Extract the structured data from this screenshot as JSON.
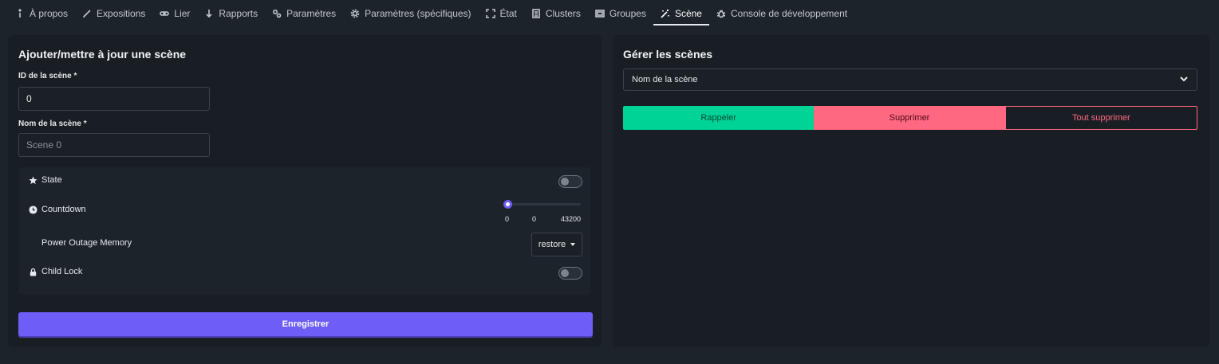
{
  "tabs": [
    {
      "label": "À propos",
      "icon": "info-icon"
    },
    {
      "label": "Expositions",
      "icon": "pencil-icon"
    },
    {
      "label": "Lier",
      "icon": "link-icon"
    },
    {
      "label": "Rapports",
      "icon": "arrow-down-icon"
    },
    {
      "label": "Paramètres",
      "icon": "cogs-icon"
    },
    {
      "label": "Paramètres (spécifiques)",
      "icon": "gear-icon"
    },
    {
      "label": "État",
      "icon": "expand-icon"
    },
    {
      "label": "Clusters",
      "icon": "list-icon"
    },
    {
      "label": "Groupes",
      "icon": "group-icon"
    },
    {
      "label": "Scène",
      "icon": "magic-wand-icon",
      "active": true
    },
    {
      "label": "Console de développement",
      "icon": "bug-icon"
    }
  ],
  "left": {
    "title": "Ajouter/mettre à jour une scène",
    "scene_id_label": "ID de la scène *",
    "scene_id_value": "0",
    "scene_name_label": "Nom de la scène *",
    "scene_name_placeholder": "Scene 0",
    "state_label": "State",
    "countdown_label": "Countdown",
    "countdown_min": "0",
    "countdown_value": "0",
    "countdown_max": "43200",
    "power_outage_label": "Power Outage Memory",
    "power_outage_value": "restore",
    "child_lock_label": "Child Lock",
    "save_label": "Enregistrer"
  },
  "right": {
    "title": "Gérer les scènes",
    "scene_select_placeholder": "Nom de la scène",
    "recall_label": "Rappeler",
    "delete_label": "Supprimer",
    "delete_all_label": "Tout supprimer"
  },
  "colors": {
    "accent": "#6c5ef6",
    "success": "#00d396",
    "danger": "#ff6880"
  }
}
